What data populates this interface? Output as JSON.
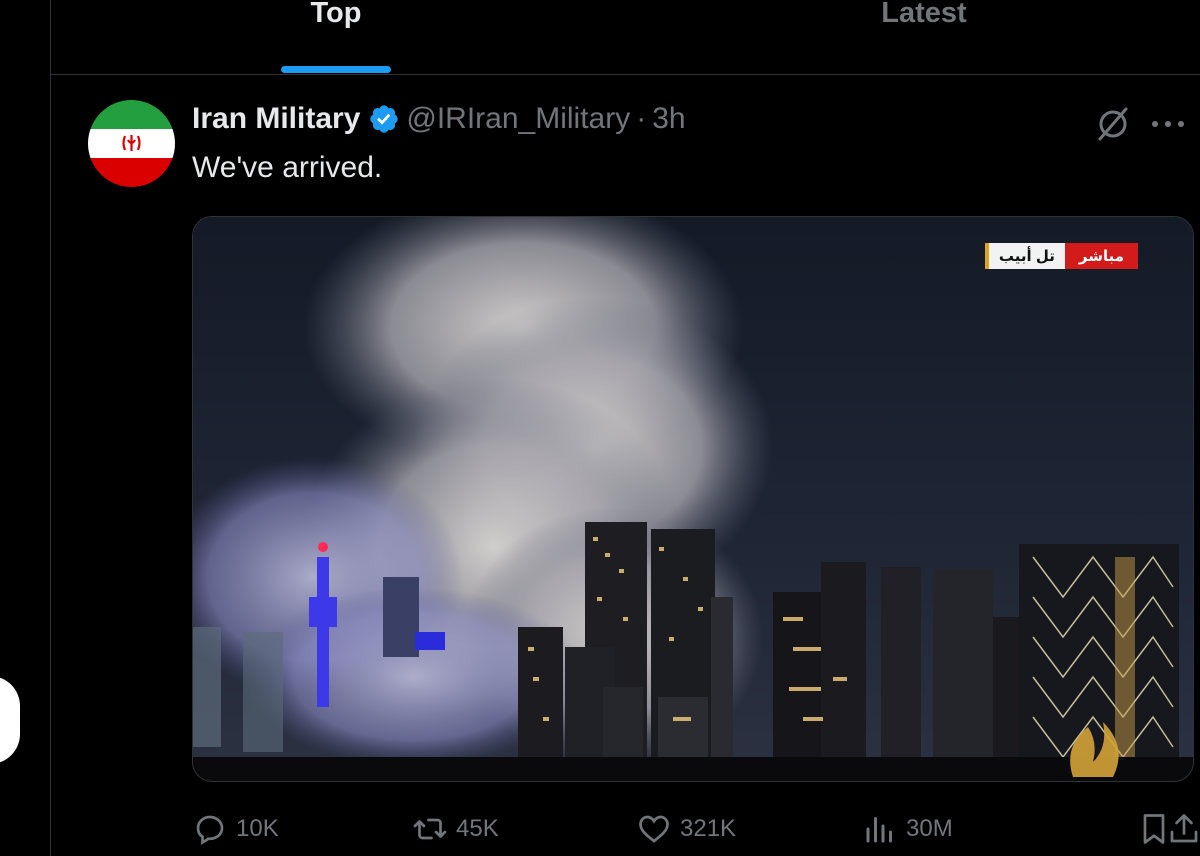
{
  "tabs": [
    {
      "label": "Top",
      "active": true
    },
    {
      "label": "Latest",
      "active": false
    }
  ],
  "tweet": {
    "display_name": "Iran Military",
    "handle": "@IRIran_Military",
    "separator": "·",
    "time": "3h",
    "text": "We've arrived.",
    "avatar_icon": "iran-flag-avatar",
    "media": {
      "banner_city": "تل أبيب",
      "banner_live": "مباشر",
      "logo": "aljazeera-logo"
    },
    "stats": {
      "replies": "10K",
      "reposts": "45K",
      "likes": "321K",
      "views": "30M"
    }
  },
  "colors": {
    "accent": "#1d9bf0",
    "background": "#000000",
    "muted_text": "#71767b",
    "live_red": "#d41b1b"
  }
}
